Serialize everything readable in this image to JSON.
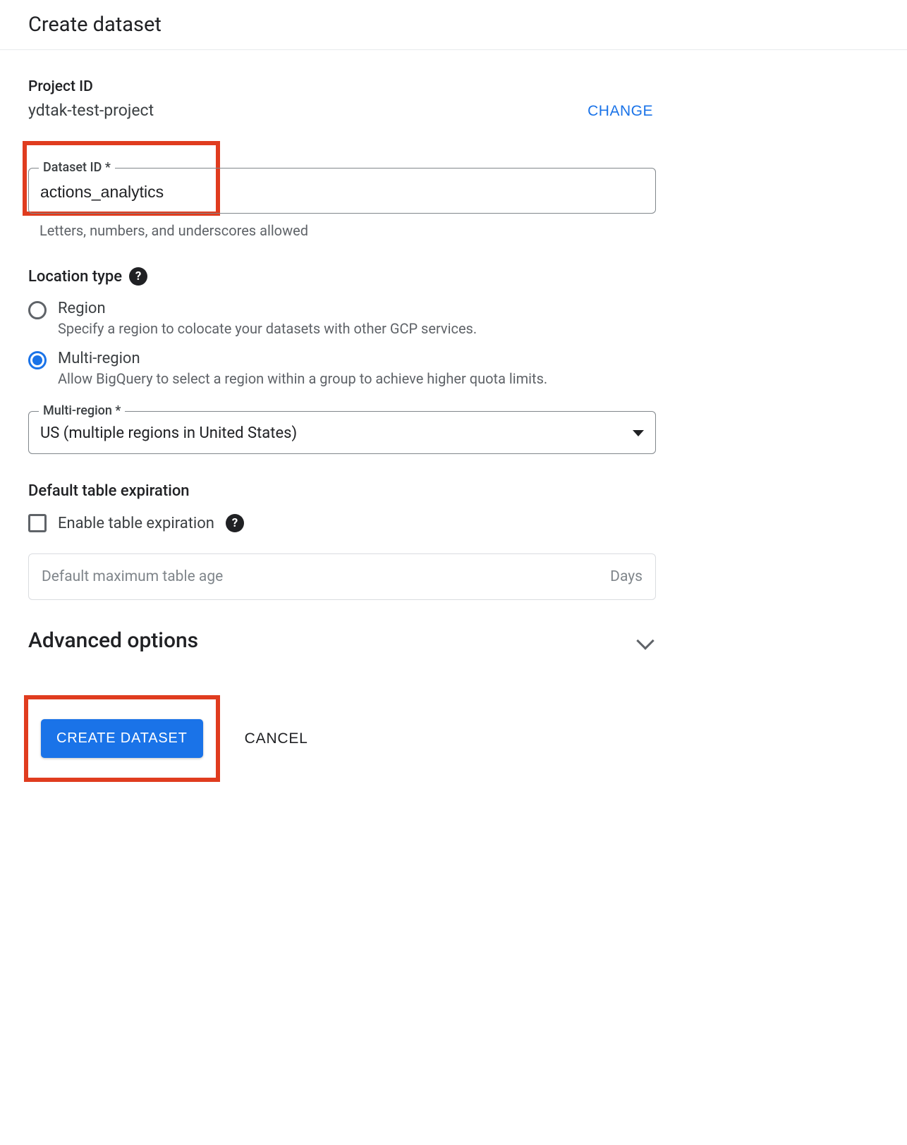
{
  "header": {
    "title": "Create dataset"
  },
  "project": {
    "label": "Project ID",
    "value": "ydtak-test-project",
    "change": "CHANGE"
  },
  "dataset_id": {
    "label": "Dataset ID *",
    "value": "actions_analytics",
    "helper": "Letters, numbers, and underscores allowed"
  },
  "location": {
    "title": "Location type",
    "region": {
      "label": "Region",
      "desc": "Specify a region to colocate your datasets with other GCP services."
    },
    "multi": {
      "label": "Multi-region",
      "desc": "Allow BigQuery to select a region within a group to achieve higher quota limits."
    }
  },
  "multi_select": {
    "label": "Multi-region *",
    "value": "US (multiple regions in United States)"
  },
  "expiration": {
    "title": "Default table expiration",
    "checkbox": "Enable table expiration",
    "placeholder": "Default maximum table age",
    "unit": "Days"
  },
  "advanced": {
    "title": "Advanced options"
  },
  "actions": {
    "create": "CREATE DATASET",
    "cancel": "CANCEL"
  }
}
